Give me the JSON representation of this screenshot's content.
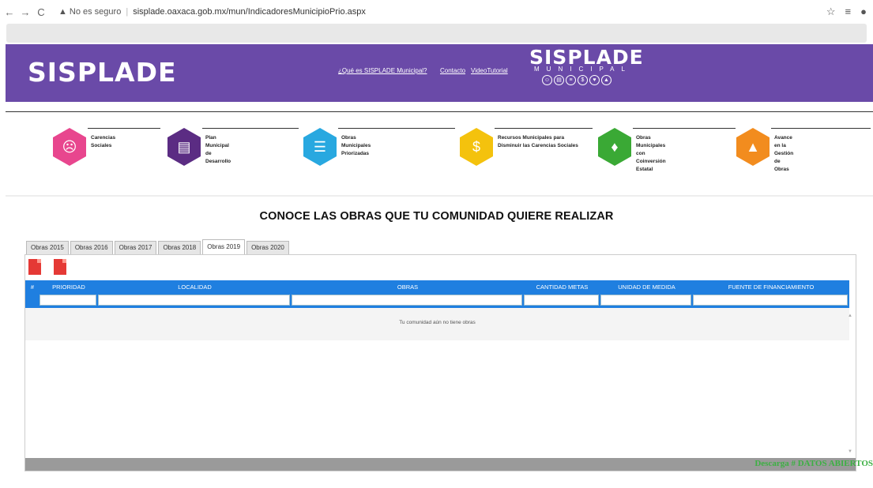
{
  "browser": {
    "security": "No es seguro",
    "url": "sisplade.oaxaca.gob.mx/mun/IndicadoresMunicipioPrio.aspx"
  },
  "header": {
    "logo_left": "SISPLADE",
    "links": [
      "¿Qué es SISPLADE Municipal?",
      "Contacto",
      "VideoTutorial"
    ],
    "logo_right": "SISPLADE",
    "logo_right_sub": "MUNICIPAL"
  },
  "categories": [
    {
      "label": "Carencias Sociales",
      "icon": "sad-face-icon",
      "color": "#e8468e"
    },
    {
      "label": "Plan Municipal de Desarrollo",
      "icon": "document-icon",
      "color": "#5b2c83"
    },
    {
      "label": "Obras Municipales Priorizadas",
      "icon": "list-icon",
      "color": "#28a8e0"
    },
    {
      "label": "Recursos Municipales para Disminuir las Carencias Sociales",
      "icon": "dollar-icon",
      "color": "#f4c20d"
    },
    {
      "label": "Obras Municipales con Coinversión Estatal",
      "icon": "handshake-icon",
      "color": "#3aa935"
    },
    {
      "label": "Avance en la Gestión de Obras",
      "icon": "excavator-icon",
      "color": "#f28c1e"
    }
  ],
  "main_title": "CONOCE LAS OBRAS QUE TU COMUNIDAD QUIERE REALIZAR",
  "tabs": [
    "Obras 2015",
    "Obras 2016",
    "Obras 2017",
    "Obras 2018",
    "Obras 2019",
    "Obras 2020"
  ],
  "active_tab": "Obras 2019",
  "grid": {
    "columns": [
      "#",
      "PRIORIDAD",
      "LOCALIDAD",
      "OBRAS",
      "CANTIDAD METAS",
      "UNIDAD DE MEDIDA",
      "FUENTE DE FINANCIAMIENTO"
    ],
    "empty_message": "Tu comunidad aún no tiene obras"
  },
  "download_label": "Descarga # DATOS ABIERTOS"
}
